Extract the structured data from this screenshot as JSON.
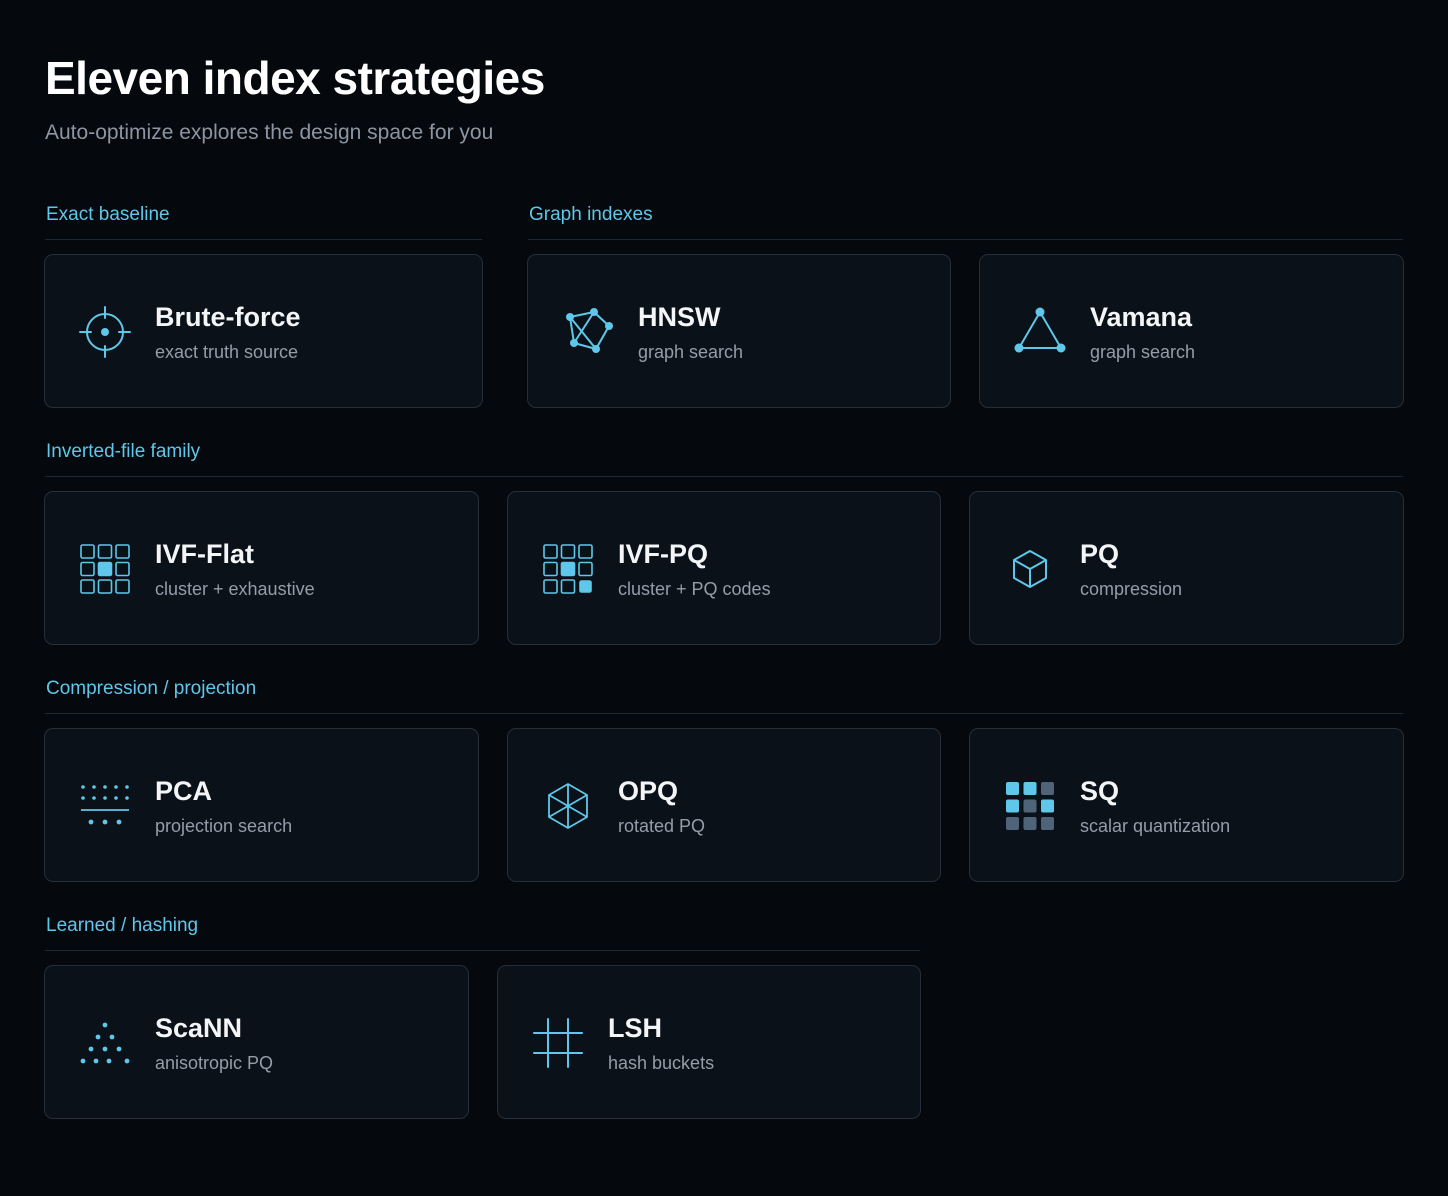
{
  "header": {
    "title": "Eleven index strategies",
    "subtitle": "Auto-optimize explores the design space for you"
  },
  "colors": {
    "background": "#05080c",
    "card": "#0b1118",
    "card_border": "#252e39",
    "accent": "#5ec7ea",
    "accent_muted": "#4f6478"
  },
  "sections": {
    "exact": {
      "label": "Exact baseline",
      "cards": {
        "bruteforce": {
          "name": "Brute-force",
          "desc": "exact truth source",
          "icon": "crosshair-icon"
        }
      }
    },
    "graph": {
      "label": "Graph indexes",
      "cards": {
        "hnsw": {
          "name": "HNSW",
          "desc": "graph search",
          "icon": "graph-nodes-icon"
        },
        "vamana": {
          "name": "Vamana",
          "desc": "graph search",
          "icon": "triangle-graph-icon"
        }
      }
    },
    "ivf": {
      "label": "Inverted-file family",
      "cards": {
        "ivfflat": {
          "name": "IVF-Flat",
          "desc": "cluster + exhaustive",
          "icon": "grid-cluster-icon"
        },
        "ivfpq": {
          "name": "IVF-PQ",
          "desc": "cluster + PQ codes",
          "icon": "grid-cluster-codes-icon"
        },
        "pq": {
          "name": "PQ",
          "desc": "compression",
          "icon": "cube-icon"
        }
      }
    },
    "compression": {
      "label": "Compression / projection",
      "cards": {
        "pca": {
          "name": "PCA",
          "desc": "projection search",
          "icon": "projection-dots-icon"
        },
        "opq": {
          "name": "OPQ",
          "desc": "rotated PQ",
          "icon": "rotated-cube-icon"
        },
        "sq": {
          "name": "SQ",
          "desc": "scalar quantization",
          "icon": "quantization-grid-icon"
        }
      }
    },
    "learned": {
      "label": "Learned / hashing",
      "cards": {
        "scann": {
          "name": "ScaNN",
          "desc": "anisotropic PQ",
          "icon": "dot-pyramid-icon"
        },
        "lsh": {
          "name": "LSH",
          "desc": "hash buckets",
          "icon": "hash-grid-icon"
        }
      }
    }
  }
}
